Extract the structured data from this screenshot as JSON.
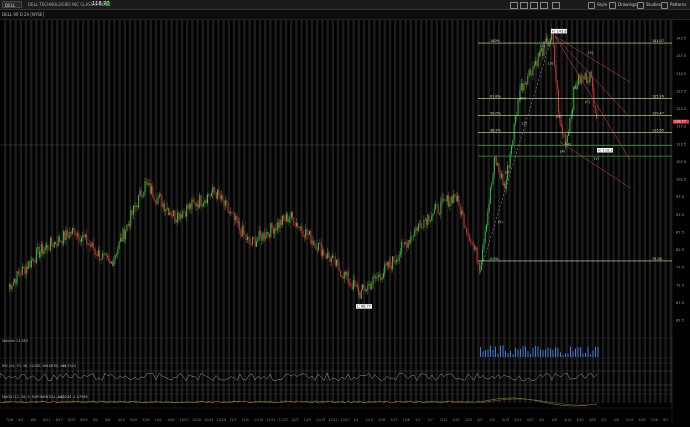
{
  "toolbar": {
    "symbol": "DELL",
    "company": "DELL TECHNOLOGIES INC CLASS C COM",
    "price": "118.77",
    "style_label": "Style",
    "drawings_label": "Drawings",
    "studies_label": "Studies",
    "patterns_label": "Patterns"
  },
  "chart_header": "DELL 90 D 2h [NYSE]",
  "panes": {
    "volume_label": "Volume",
    "volume_value": "13,363",
    "rsi_label": "RSI (14, 70, 30, CLOSE, WILDERS, no)",
    "rsi_value": "39.5324",
    "rsi_upper": "70",
    "rsi_lower": "30",
    "macd_label": "MACD (12, 26, 9, EXPONENTIAL, no)",
    "macd_values": "-1.28244  -1.07996"
  },
  "fib_labels": {
    "top_left": "100%",
    "top_val": "141.07",
    "pct618": "61.8%",
    "val618": "125.29",
    "pct50": "50.0%",
    "val50": "120.47",
    "pct382": "38.2%",
    "val382": "115.65",
    "pct0": "0.0%",
    "val0": "79.26"
  },
  "annotations": {
    "peak": "H: 143.8",
    "low": "L: 68.77",
    "mid": "H: 110.27",
    "waves": [
      "(1)",
      "(2)",
      "(3)",
      "(4)",
      "(5)",
      "(i)",
      "(ii)",
      "(iii)",
      "(iv)",
      "(v)",
      "(A)",
      "(B)",
      "(C)"
    ]
  },
  "y_axis": [
    "142.5",
    "137.5",
    "132.5",
    "127.5",
    "122.5",
    "117.5",
    "112.5",
    "107.5",
    "102.5",
    "97.5",
    "92.5",
    "87.5",
    "82.5",
    "77.5",
    "72.5",
    "67.5",
    "62.5"
  ],
  "x_axis": [
    "7/28",
    "8/2",
    "8/8",
    "8/11",
    "8/17",
    "8/23",
    "8/29",
    "9/2",
    "9/8",
    "9/14",
    "9/20",
    "9/26",
    "10/2",
    "10/6",
    "10/12",
    "10/18",
    "10/24",
    "10/28",
    "11/3",
    "11/9",
    "11/15",
    "11/21",
    "11/27",
    "12/3",
    "12/9",
    "12/15",
    "12/21",
    "12/27",
    "1/4",
    "1/10",
    "1/16",
    "1/22",
    "1/26",
    "2/1",
    "2/7",
    "2/13",
    "2/19",
    "2/25",
    "3/3",
    "3/9",
    "3/15",
    "3/21",
    "3/27",
    "4/2",
    "4/8",
    "4/14",
    "4/20",
    "4/26",
    "5/2",
    "5/8",
    "5/14",
    "5/20",
    "5/26",
    "6/1"
  ],
  "colors": {
    "up": "#2ecc40",
    "down": "#e0383a",
    "fib": "#c8f0a0",
    "fan": "#e04060",
    "session": "#1c1c1c"
  }
}
